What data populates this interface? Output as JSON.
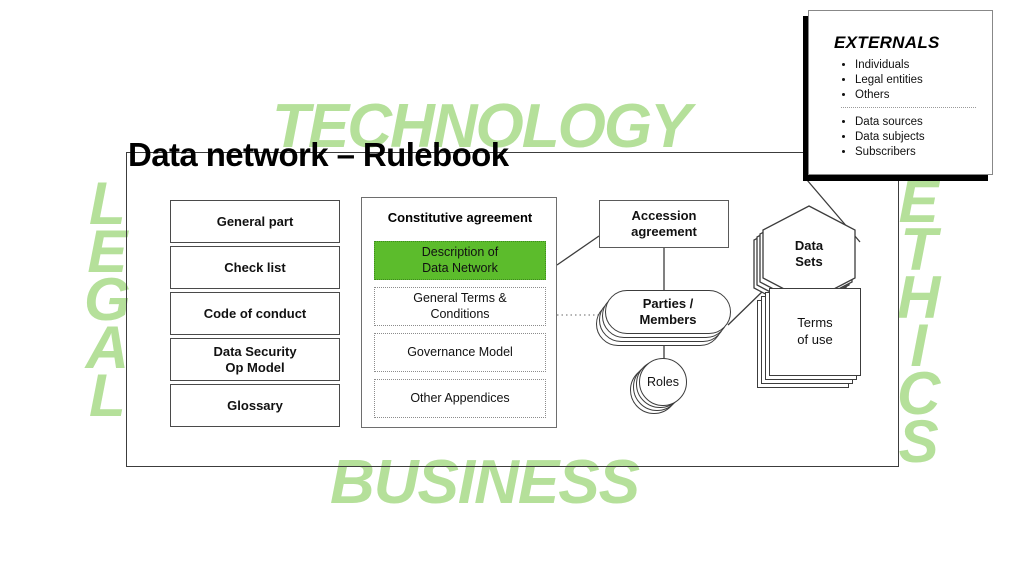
{
  "page": {
    "title": "Data network – Rulebook",
    "accent_green": "#5cbc2c",
    "watermark_green": "#b5e09a",
    "line_color": "#3c3c3c"
  },
  "watermarks": {
    "technology": "TECHNOLOGY",
    "business": "BUSINESS",
    "legal": "LEGAL",
    "ethics": "ETHICS"
  },
  "left_column": {
    "items": [
      {
        "label": "General part"
      },
      {
        "label": "Check list"
      },
      {
        "label": "Code of conduct"
      },
      {
        "label": "Data Security\nOp Model"
      },
      {
        "label": "Glossary"
      }
    ]
  },
  "constitutive": {
    "title": "Constitutive agreement",
    "items": [
      {
        "label": "Description of\nData Network",
        "highlighted": true
      },
      {
        "label": "General Terms &\nConditions",
        "highlighted": false
      },
      {
        "label": "Governance Model",
        "highlighted": false
      },
      {
        "label": "Other Appendices",
        "highlighted": false
      }
    ]
  },
  "nodes": {
    "accession": "Accession\nagreement",
    "parties": "Parties /\nMembers",
    "roles": "Roles",
    "data_sets": "Data\nSets",
    "terms_of_use": "Terms\nof use"
  },
  "externals": {
    "title": "EXTERNALS",
    "group_one": [
      "Individuals",
      "Legal entities",
      "Others"
    ],
    "group_two": [
      "Data sources",
      "Data subjects",
      "Subscribers"
    ]
  }
}
